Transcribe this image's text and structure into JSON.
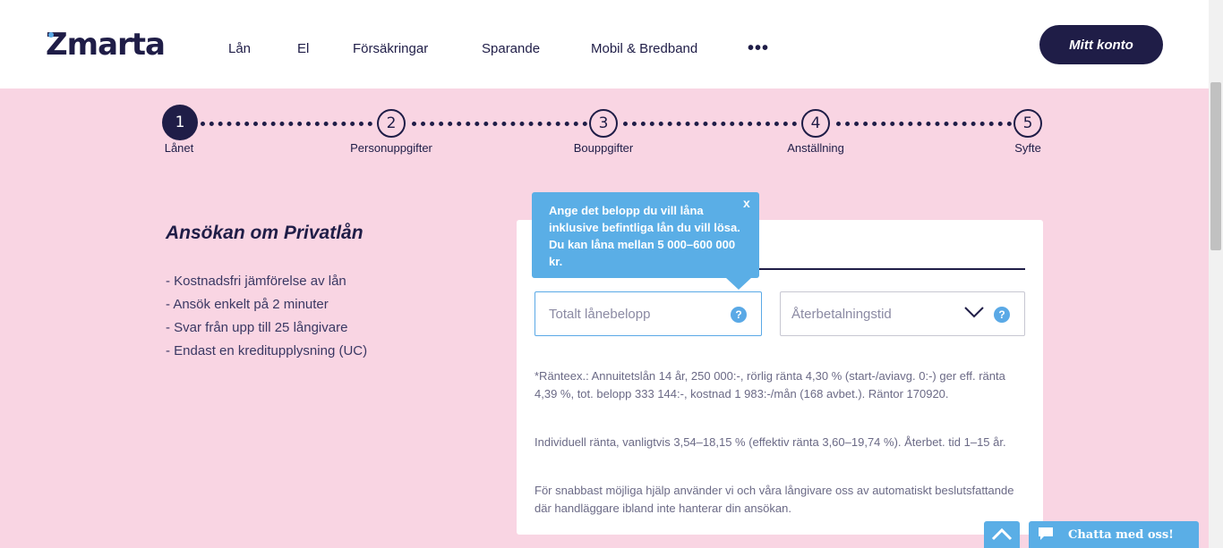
{
  "brand": {
    "name": "Zmarta",
    "accent": "#5aa9e6",
    "navy": "#1f1d47",
    "background": "#f9d5e3"
  },
  "nav": {
    "items": [
      {
        "label": "Lån"
      },
      {
        "label": "El"
      },
      {
        "label": "Försäkringar"
      },
      {
        "label": "Sparande"
      },
      {
        "label": "Mobil & Bredband"
      }
    ],
    "more_label": "•••",
    "account_label": "Mitt konto"
  },
  "steps": [
    {
      "number": "1",
      "label": "Lånet",
      "active": true
    },
    {
      "number": "2",
      "label": "Personuppgifter",
      "active": false
    },
    {
      "number": "3",
      "label": "Bouppgifter",
      "active": false
    },
    {
      "number": "4",
      "label": "Anställning",
      "active": false
    },
    {
      "number": "5",
      "label": "Syfte",
      "active": false
    }
  ],
  "intro": {
    "title": "Ansökan om Privatlån",
    "bullets": [
      "- Kostnadsfri jämförelse av lån",
      "- Ansök enkelt på 2 minuter",
      "- Svar från upp till 25 långivare",
      "- Endast en kreditupplysning (UC)"
    ]
  },
  "form": {
    "amount_placeholder": "Totalt lånebelopp",
    "period_placeholder": "Återbetalningstid",
    "help_glyph": "?",
    "tooltip_text": "Ange det belopp du vill låna inklusive befintliga lån du vill lösa. Du kan låna mellan 5 000–600 000 kr.",
    "tooltip_close": "x"
  },
  "fine_print": [
    "*Ränteex.: Annuitetslån 14 år, 250 000:-, rörlig ränta 4,30 % (start-/aviavg. 0:-) ger eff. ränta 4,39 %, tot. belopp 333 144:-, kostnad 1 983:-/mån (168 avbet.). Räntor 170920.",
    "Individuell ränta, vanligtvis 3,54–18,15 % (effektiv ränta 3,60–19,74 %). Återbet. tid 1–15 år.",
    "För snabbast möjliga hjälp använder vi och våra långivare oss av automatiskt beslutsfattande där handläggare ibland inte hanterar din ansökan."
  ],
  "widgets": {
    "chat_label": "Chatta med oss!",
    "scroll_top_icon": "chevron-up-icon",
    "chat_icon": "chat-bubble-icon"
  }
}
